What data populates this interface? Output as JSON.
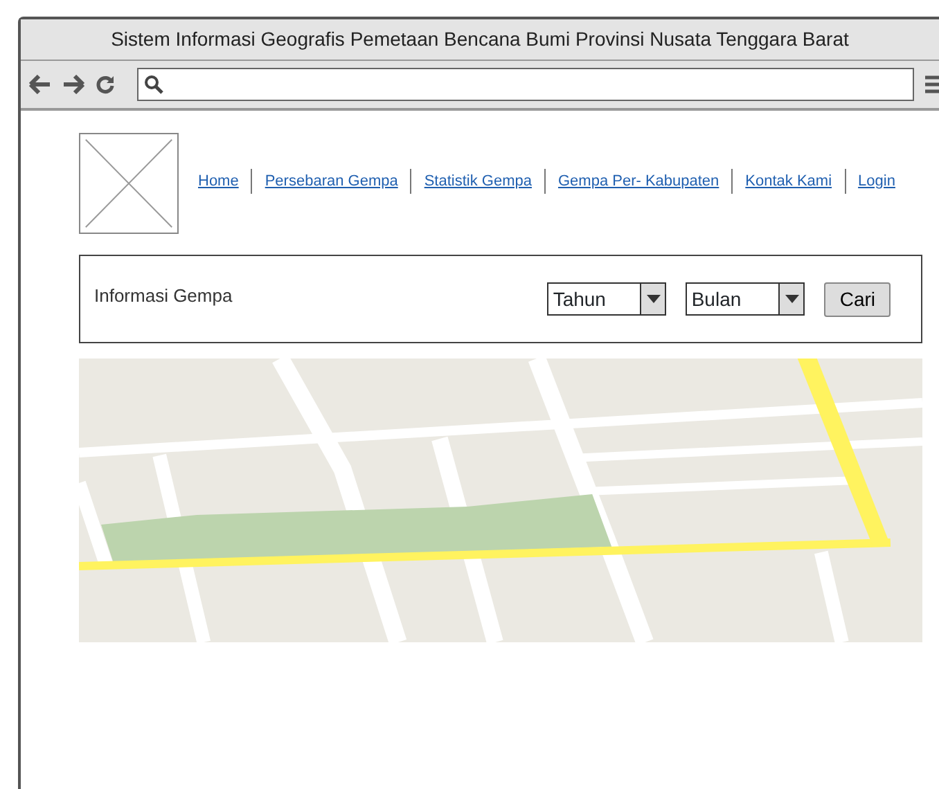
{
  "window": {
    "title": "Sistem Informasi Geografis Pemetaan Bencana Bumi Provinsi Nusata Tenggara Barat"
  },
  "nav": [
    {
      "label": "Home"
    },
    {
      "label": "Persebaran Gempa"
    },
    {
      "label": "Statistik Gempa"
    },
    {
      "label": "Gempa Per- Kabupaten"
    },
    {
      "label": "Kontak Kami"
    },
    {
      "label": "Login"
    }
  ],
  "panel": {
    "title": "Informasi Gempa",
    "selects": [
      {
        "value": "Tahun"
      },
      {
        "value": "Bulan"
      }
    ],
    "button": "Cari"
  }
}
